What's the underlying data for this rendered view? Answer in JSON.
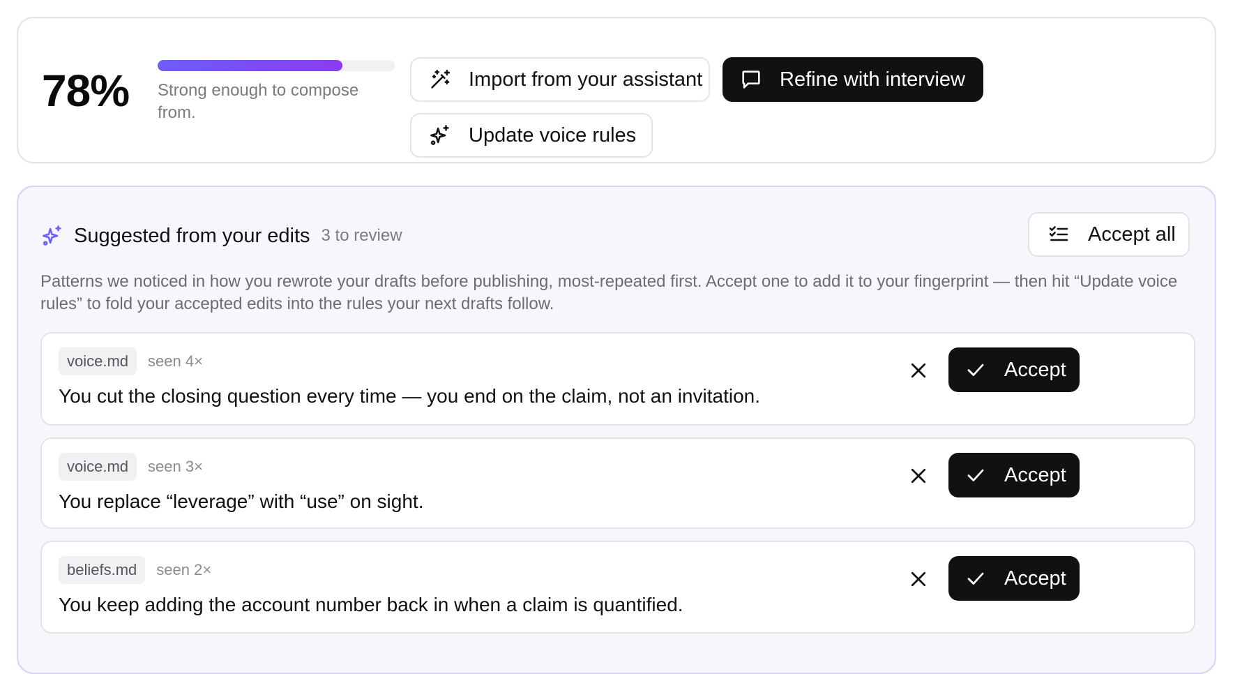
{
  "score": {
    "value": "78%",
    "progress_fraction": 0.78,
    "caption": "Strong enough to compose from."
  },
  "actions": {
    "import_label": "Import from your assistant",
    "refine_label": "Refine with interview",
    "update_label": "Update voice rules"
  },
  "suggestions": {
    "title": "Suggested from your edits",
    "count_text": "3 to review",
    "accept_all_label": "Accept all",
    "description": "Patterns we noticed in how you rewrote your drafts before publishing, most-repeated first. Accept one to add it to your fingerprint — then hit “Update voice rules” to fold your accepted edits into the rules your next drafts follow.",
    "items": [
      {
        "file": "voice.md",
        "seen": "seen 4×",
        "text": "You cut the closing question every time — you end on the claim, not an invitation.",
        "accept_label": "Accept"
      },
      {
        "file": "voice.md",
        "seen": "seen 3×",
        "text": "You replace “leverage” with “use” on sight.",
        "accept_label": "Accept"
      },
      {
        "file": "beliefs.md",
        "seen": "seen 2×",
        "text": "You keep adding the account number back in when a claim is quantified.",
        "accept_label": "Accept"
      }
    ]
  },
  "colors": {
    "accent_start": "#6d5dfc",
    "accent_end": "#8b3cf0",
    "dark_button": "#111111",
    "panel_background": "#f6f6fd"
  },
  "icons": {
    "import": "magic-wand-icon",
    "refine": "chat-bubble-icon",
    "update": "sparkles-icon",
    "suggestions": "sparkles-icon",
    "accept_all": "checklist-icon",
    "dismiss": "close-icon",
    "accept": "check-icon"
  }
}
